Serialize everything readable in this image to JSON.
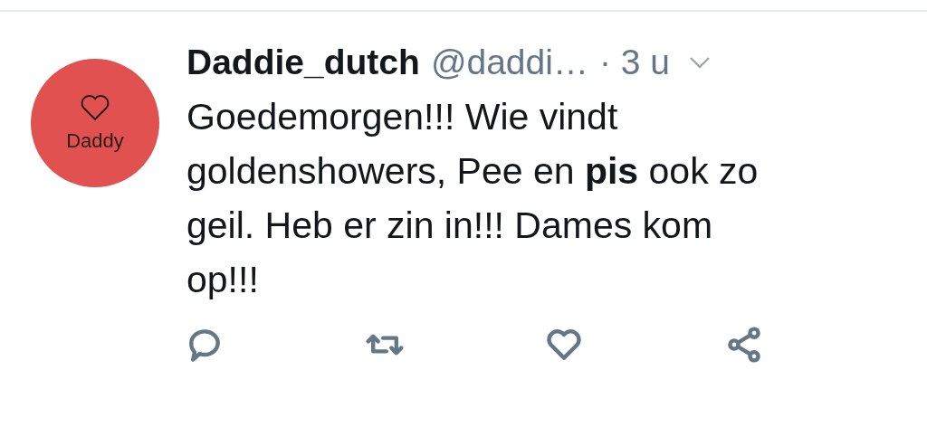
{
  "tweet": {
    "avatar": {
      "label": "Daddy"
    },
    "name": "Daddie_dutch",
    "handle": "@daddi…",
    "time": "· 3 u",
    "text": "Goedemorgen!!! Wie vindt goldenshowers, Pee en **pis** ook zo geil. Heb er zin in!!! Dames kom op!!!"
  }
}
